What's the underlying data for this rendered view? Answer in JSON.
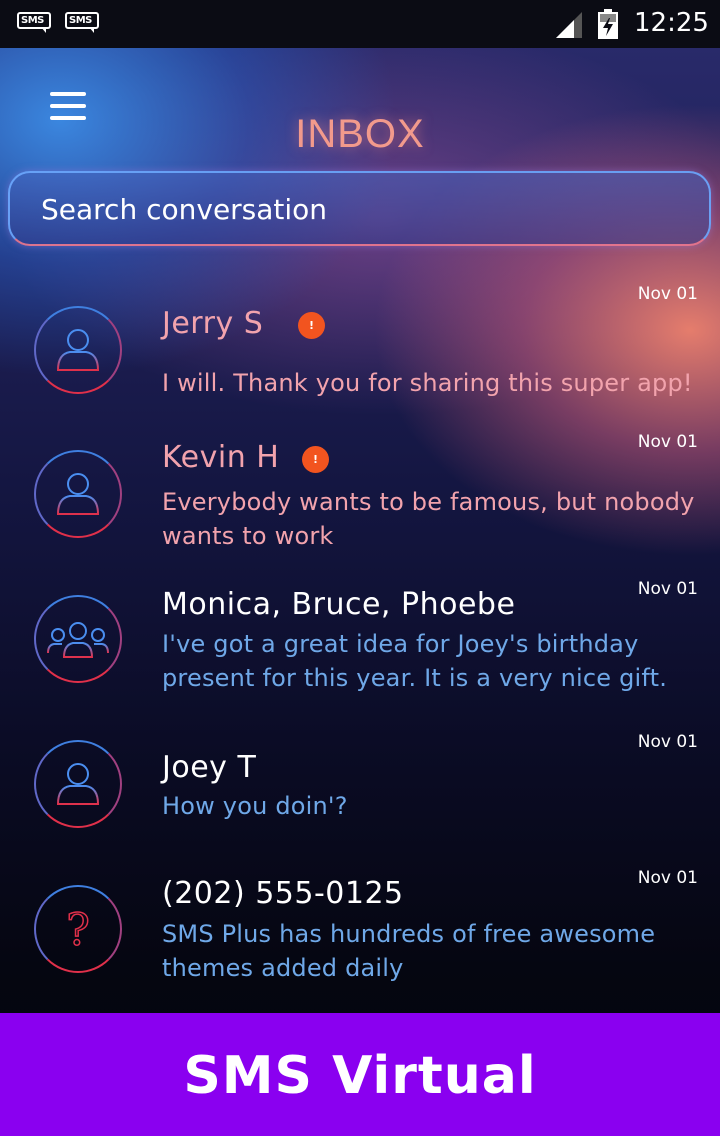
{
  "status_bar": {
    "notifications": [
      {
        "icon": "sms-notification-icon",
        "label": "SMS"
      },
      {
        "icon": "sms-notification-icon",
        "label": "SMS"
      }
    ],
    "signal_icon": "signal-icon",
    "battery_icon": "battery-charging-icon",
    "time": "12:25"
  },
  "header": {
    "menu_icon": "hamburger-menu-icon",
    "title": "INBOX"
  },
  "search": {
    "placeholder": "Search conversation"
  },
  "conversations": [
    {
      "name": "Jerry S",
      "preview": "I will. Thank you for sharing this super app!",
      "date": "Nov 01",
      "unread_badge": "!",
      "avatar": "person-icon"
    },
    {
      "name": "Kevin H",
      "preview": "Everybody wants to be famous, but nobody wants to work",
      "date": "Nov 01",
      "unread_badge": "!",
      "avatar": "person-icon"
    },
    {
      "name": "Monica, Bruce, Phoebe",
      "preview": "I've got a great idea for Joey's birthday present for this year. It is a very nice gift.",
      "date": "Nov 01",
      "avatar": "group-icon"
    },
    {
      "name": "Joey T",
      "preview": "How you doin'?",
      "date": "Nov 01",
      "avatar": "person-icon"
    },
    {
      "name": "(202) 555-0125",
      "preview": "SMS Plus has hundreds of free awesome themes added daily",
      "date": "Nov 01",
      "avatar": "unknown-contact-icon"
    }
  ],
  "colors": {
    "unread_name": "#f2a3ad",
    "unread_preview": "#f2a3ad",
    "read_name": "#ffffff",
    "read_preview": "#6fa8e8",
    "badge": "#f2541f",
    "banner": "#8a00f0",
    "title": "#f29a8c"
  },
  "banner": {
    "label": "SMS Virtual"
  }
}
